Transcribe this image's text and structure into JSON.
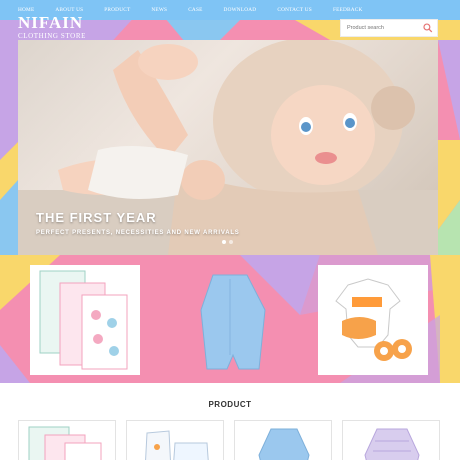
{
  "nav": {
    "items": [
      "HOME",
      "ABOUT US",
      "PRODUCT",
      "NEWS",
      "CASE",
      "DOWNLOAD",
      "CONTACT US",
      "FEEDBACK"
    ]
  },
  "brand": {
    "name": "NIFAIN",
    "subtitle": "CLOTHING STORE"
  },
  "search": {
    "placeholder": "Product search",
    "icon": "search-icon"
  },
  "hero": {
    "title": "THE FIRST YEAR",
    "subtitle": "PERFECT PRESENTS, NECESSITIES AND NEW ARRIVALS",
    "slide_count": 2,
    "active_slide": 1
  },
  "product_section": {
    "title": "PRODUCT"
  },
  "colors": {
    "nav": "#7fc4f5",
    "pink": "#f48fb1",
    "purple": "#c6a4e6",
    "yellow": "#f9d76b",
    "blue": "#8ac7f0",
    "mint": "#b7e4b0"
  }
}
